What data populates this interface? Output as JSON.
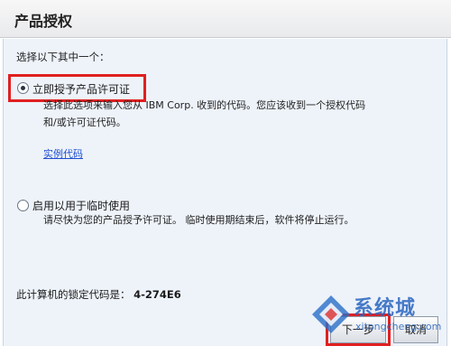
{
  "header": {
    "title": "产品授权"
  },
  "prompt": "选择以下其中一个：",
  "options": [
    {
      "label": "立即授予产品许可证",
      "checked": true,
      "description_lines": [
        "选择此选项来输入您从 IBM Corp. 收到的代码。您应该收到一个授权代码",
        "和/或许可证代码。"
      ],
      "link": "实例代码"
    },
    {
      "label": "启用以用于临时使用",
      "checked": false,
      "description_lines": [
        "请尽快为您的产品授予许可证。 临时使用期结束后，软件将停止运行。"
      ]
    }
  ],
  "lock_code": {
    "label": "此计算机的锁定代码是：",
    "value": "4-274E6"
  },
  "buttons": {
    "next": "下一步",
    "back": "取消"
  },
  "watermark": {
    "text": "系统城",
    "url": "xitongcheng.com"
  },
  "colors": {
    "highlight": "#e02020",
    "panel_bg": "#eef3fa",
    "link": "#1f4fd0"
  }
}
